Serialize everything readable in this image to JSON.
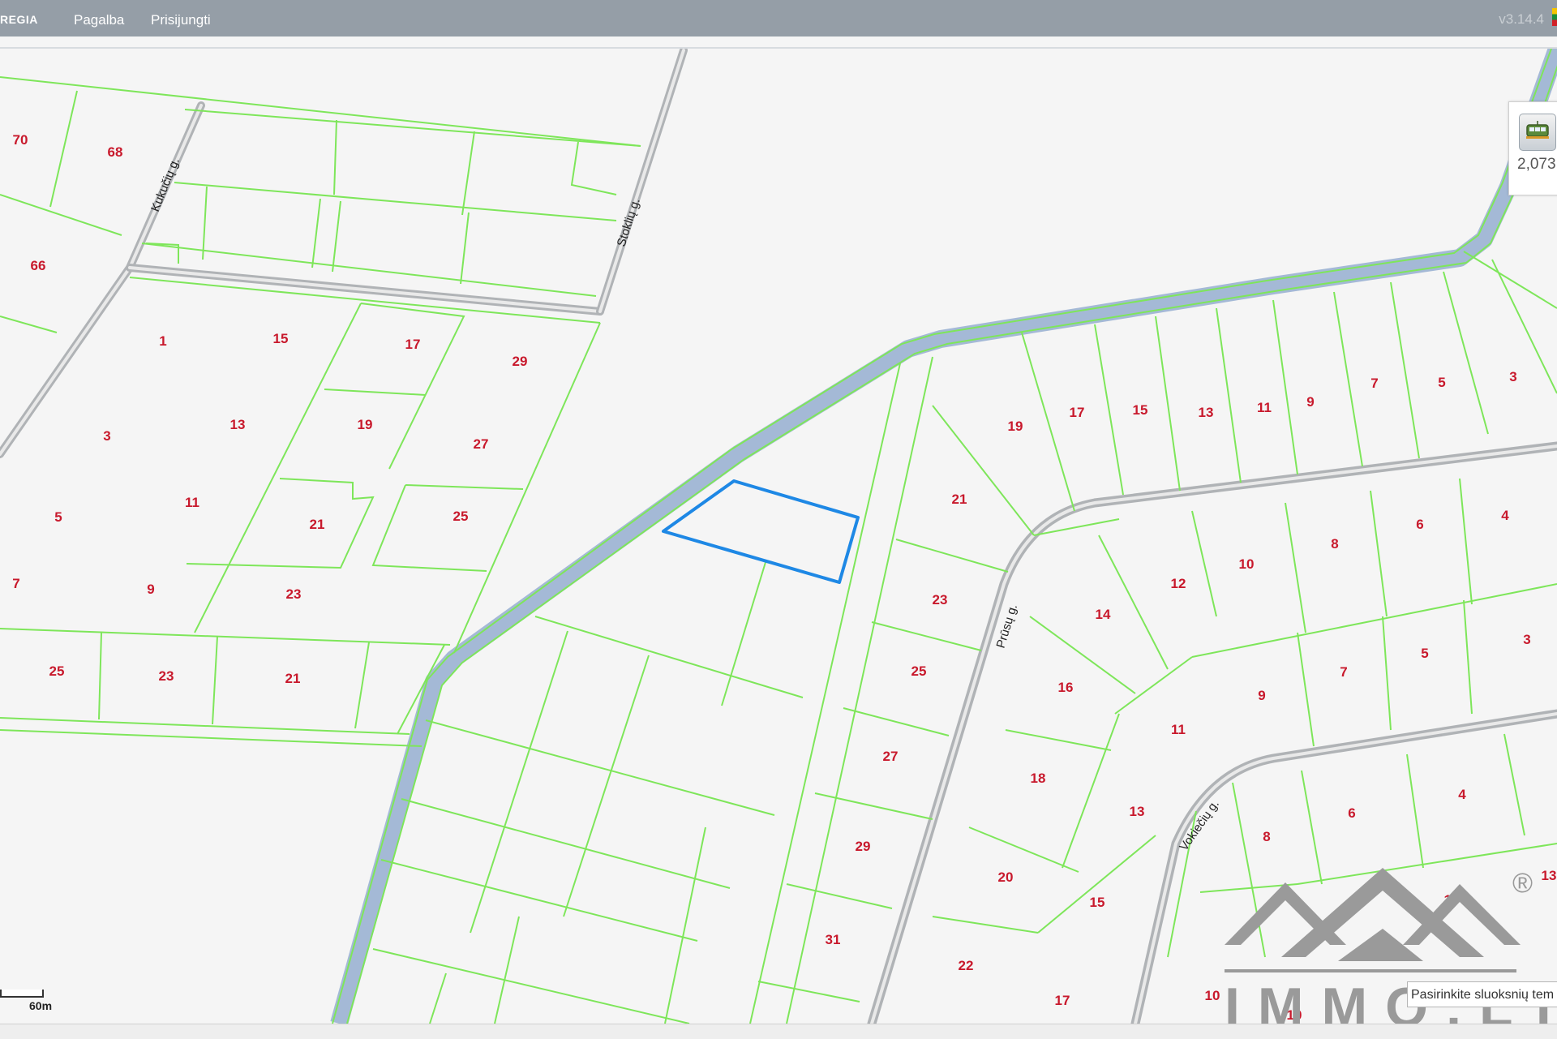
{
  "topbar": {
    "brand": "REGIA",
    "menu_help": "Pagalba",
    "menu_login": "Prisijungti",
    "version": "v3.14.4"
  },
  "streets": {
    "kukuciu": "Kukučių g.",
    "stokliu": "Stoklių g.",
    "prusu": "Prūsų g.",
    "vokieciu": "Vokiečių g."
  },
  "controls": {
    "scale_readout": "2,073",
    "scalebar_label": "60m",
    "layer_select_text": "Pasirinkite sluoksnių tem"
  },
  "watermark": {
    "text": "IMMO.LT",
    "registered": "®"
  },
  "colors": {
    "parcel_border": "#7ee65a",
    "river": "#a4b9d6",
    "selected_parcel": "#1e88e5",
    "parcel_number": "#c8192c",
    "topbar": "#959ea7"
  },
  "parcels": [
    {
      "n": "70"
    },
    {
      "n": "68"
    },
    {
      "n": "66"
    },
    {
      "n": "1"
    },
    {
      "n": "15"
    },
    {
      "n": "17"
    },
    {
      "n": "29"
    },
    {
      "n": "3"
    },
    {
      "n": "13"
    },
    {
      "n": "19"
    },
    {
      "n": "27"
    },
    {
      "n": "5"
    },
    {
      "n": "11"
    },
    {
      "n": "21"
    },
    {
      "n": "25"
    },
    {
      "n": "7"
    },
    {
      "n": "9"
    },
    {
      "n": "23"
    },
    {
      "n": "25"
    },
    {
      "n": "23"
    },
    {
      "n": "21"
    },
    {
      "n": "19"
    },
    {
      "n": "17"
    },
    {
      "n": "15"
    },
    {
      "n": "13"
    },
    {
      "n": "11"
    },
    {
      "n": "9"
    },
    {
      "n": "7"
    },
    {
      "n": "5"
    },
    {
      "n": "3"
    },
    {
      "n": "21"
    },
    {
      "n": "23"
    },
    {
      "n": "25"
    },
    {
      "n": "27"
    },
    {
      "n": "29"
    },
    {
      "n": "31"
    },
    {
      "n": "12"
    },
    {
      "n": "10"
    },
    {
      "n": "8"
    },
    {
      "n": "6"
    },
    {
      "n": "4"
    },
    {
      "n": "14"
    },
    {
      "n": "16"
    },
    {
      "n": "18"
    },
    {
      "n": "20"
    },
    {
      "n": "22"
    },
    {
      "n": "9"
    },
    {
      "n": "7"
    },
    {
      "n": "5"
    },
    {
      "n": "3"
    },
    {
      "n": "11"
    },
    {
      "n": "13"
    },
    {
      "n": "15"
    },
    {
      "n": "17"
    },
    {
      "n": "8"
    },
    {
      "n": "6"
    },
    {
      "n": "4"
    },
    {
      "n": "13"
    },
    {
      "n": "15"
    },
    {
      "n": "10"
    },
    {
      "n": "10"
    }
  ]
}
